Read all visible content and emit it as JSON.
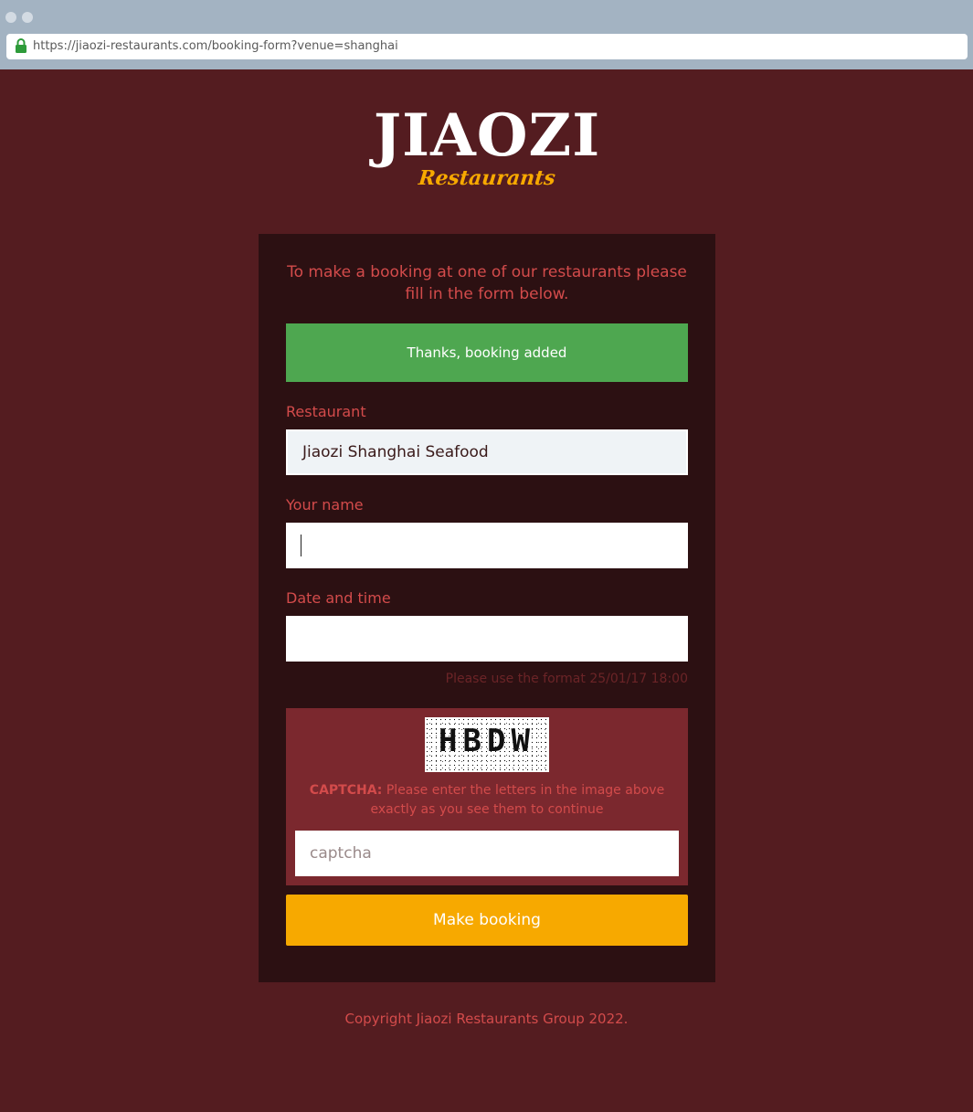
{
  "browser": {
    "url": "https://jiaozi-restaurants.com/booking-form?venue=shanghai"
  },
  "logo": {
    "main": "JIAOZI",
    "sub": "Restaurants",
    "main_color": "#ffffff",
    "sub_color": "#f7a900"
  },
  "form": {
    "intro": "To make a booking at one of our restaurants please fill in the form below.",
    "success_message": "Thanks, booking added",
    "restaurant_label": "Restaurant",
    "restaurant_value": "Jiaozi Shanghai Seafood",
    "name_label": "Your name",
    "name_value": "",
    "datetime_label": "Date and time",
    "datetime_value": "",
    "datetime_hint": "Please use the format 25/01/17 18:00",
    "captcha": {
      "image_text": "HBDW",
      "label_bold": "CAPTCHA:",
      "label_text": " Please enter the letters in the image above exactly as you see them to continue",
      "placeholder": "captcha"
    },
    "submit_label": "Make booking"
  },
  "footer": {
    "copyright": "Copyright Jiaozi Restaurants Group 2022."
  },
  "colors": {
    "background": "#541c20",
    "card": "#2c1012",
    "accent_text": "#d34b4b",
    "success": "#4ea750",
    "captcha_box": "#7b282e",
    "button": "#f7a900"
  }
}
